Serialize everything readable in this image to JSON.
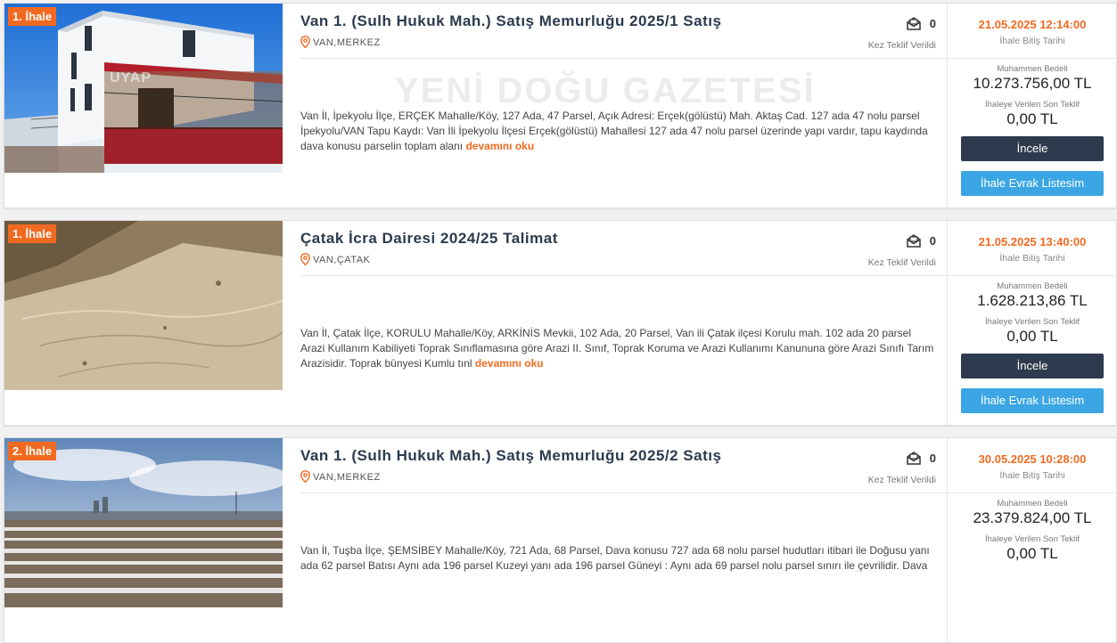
{
  "labels": {
    "bids_label": "Kez Teklif Verildi",
    "end_date_label": "İhale Bitiş Tarihi",
    "estimated_label": "Muhammen Bedeli",
    "last_bid_label": "İhaleye Verilen Son Teklif",
    "inspect_button": "İncele",
    "docs_button": "İhale Evrak Listesim",
    "read_more": "devamını oku"
  },
  "photo_watermark": "UYAP",
  "gazette_watermark": "YENİ DOĞU GAZETESİ",
  "listings": [
    {
      "badge": "1. İhale",
      "title": "Van 1. (Sulh Hukuk Mah.) Satış Memurluğu 2025/1 Satış",
      "location": "VAN,MERKEZ",
      "bid_count": "0",
      "description": "Van İl, İpekyolu İlçe, ERÇEK Mahalle/Köy, 127 Ada, 47 Parsel, Açık Adresi: Erçek(gölüstü) Mah. Aktaş Cad. 127 ada 47 nolu parsel İpekyolu/VAN Tapu Kaydı: Van İli İpekyolu İlçesi Erçek(gölüstü) Mahallesi 127 ada 47 nolu parsel üzerinde yapı vardır, tapu kaydında dava konusu parselin toplam alanı",
      "end_date": "21.05.2025 12:14:00",
      "estimated_value": "10.273.756,00 TL",
      "last_bid": "0,00 TL"
    },
    {
      "badge": "1. İhale",
      "title": "Çatak İcra Dairesi 2024/25 Talimat",
      "location": "VAN,ÇATAK",
      "bid_count": "0",
      "description": "Van İl, Çatak İlçe, KORULU Mahalle/Köy, ARKİNİS Mevkii, 102 Ada, 20 Parsel, Van ili Çatak ilçesi Korulu mah. 102 ada 20 parsel Arazi Kullanım Kabiliyeti Toprak Sınıflamasına göre Arazi II. Sınıf, Toprak Koruma ve Arazi Kullanımı Kanununa göre Arazi Sınıfı Tarım Arazisidir. Toprak bünyesi Kumlu tınl",
      "end_date": "21.05.2025 13:40:00",
      "estimated_value": "1.628.213,86 TL",
      "last_bid": "0,00 TL"
    },
    {
      "badge": "2. İhale",
      "title": "Van 1. (Sulh Hukuk Mah.) Satış Memurluğu 2025/2 Satış",
      "location": "VAN,MERKEZ",
      "bid_count": "0",
      "description": "Van İl, Tuşba İlçe, ŞEMSİBEY Mahalle/Köy, 721 Ada, 68 Parsel, Dava konusu 727 ada 68 nolu parsel hudutları itibari ile Doğusu yanı ada 62 parsel Batısı Aynı ada 196 parsel Kuzeyi yanı ada 196 parsel Güneyi : Aynı ada 69 parsel nolu parsel sınırı ile çevrilidir. Dava",
      "end_date": "30.05.2025 10:28:00",
      "estimated_value": "23.379.824,00 TL",
      "last_bid": "0,00 TL"
    }
  ],
  "colors": {
    "accent_orange": "#f26a21",
    "title_navy": "#2b3a4e",
    "button_dark": "#2e3b4e",
    "button_blue": "#3ba6e3"
  }
}
